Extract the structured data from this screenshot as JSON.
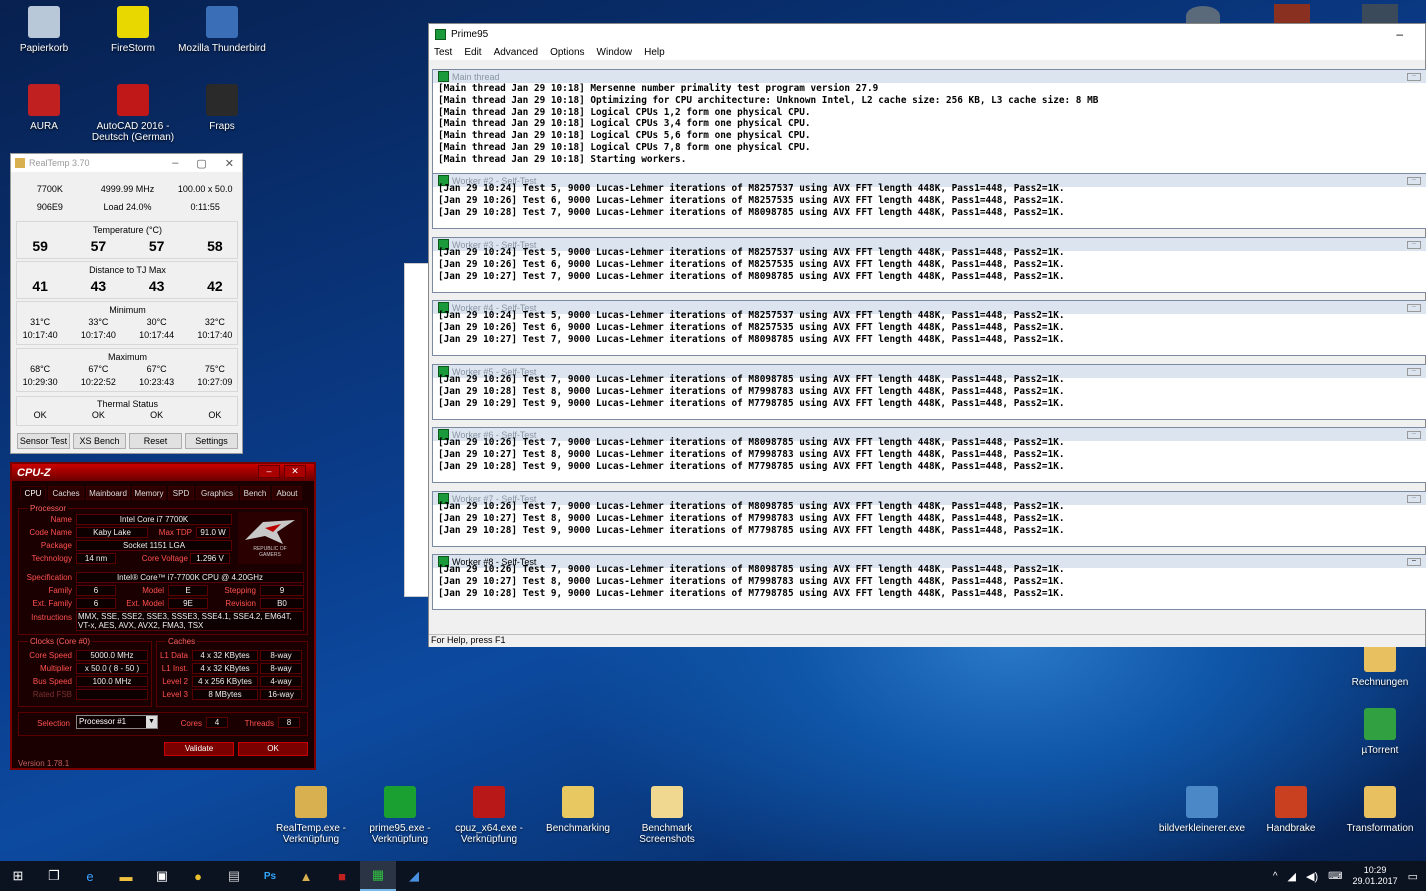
{
  "desktop_icons_left": [
    {
      "label": "Papierkorb",
      "icon": "recycle-bin-icon",
      "color": "#b8c8d8"
    },
    {
      "label": "FireStorm",
      "icon": "firestorm-icon",
      "color": "#e8d800"
    },
    {
      "label": "Mozilla Thunderbird",
      "icon": "thunderbird-icon",
      "color": "#3a6fb8"
    },
    {
      "label": "AURA",
      "icon": "aura-icon",
      "color": "#c02020"
    },
    {
      "label": "AutoCAD 2016 - Deutsch (German)",
      "icon": "autocad-icon",
      "color": "#c01818"
    },
    {
      "label": "Fraps",
      "icon": "fraps-icon",
      "color": "#2a2a2a"
    }
  ],
  "desktop_icons_bottom": [
    {
      "label": "RealTemp.exe - Verknüpfung",
      "icon": "realtemp-icon",
      "color": "#d8b050"
    },
    {
      "label": "prime95.exe - Verknüpfung",
      "icon": "prime95-icon",
      "color": "#1aa030"
    },
    {
      "label": "cpuz_x64.exe - Verknüpfung",
      "icon": "cpuz-icon",
      "color": "#b81818"
    },
    {
      "label": "Benchmarking",
      "icon": "folder-icon",
      "color": "#e8c860"
    },
    {
      "label": "Benchmark Screenshots",
      "icon": "folder-icon",
      "color": "#f0d890"
    }
  ],
  "desktop_icons_right": [
    {
      "label": "bildverkleinerer.exe",
      "icon": "image-resizer-icon",
      "color": "#4a88c8"
    },
    {
      "label": "Handbrake",
      "icon": "handbrake-icon",
      "color": "#c84020"
    },
    {
      "label": "Transformation",
      "icon": "folder-icon",
      "color": "#e8c060"
    },
    {
      "label": "Rechnungen",
      "icon": "folder-icon",
      "color": "#e8c060"
    },
    {
      "label": "µTorrent",
      "icon": "utorrent-icon",
      "color": "#30a040"
    }
  ],
  "realtemp": {
    "title": "RealTemp 3.70",
    "cpu": "7700K",
    "mhz": "4999.99 MHz",
    "mult": "100.00 x 50.0",
    "cpuid": "906E9",
    "load": "Load  24.0%",
    "time": "0:11:55",
    "temp_title": "Temperature (°C)",
    "temps": [
      "59",
      "57",
      "57",
      "58"
    ],
    "dist_title": "Distance to TJ Max",
    "dists": [
      "41",
      "43",
      "43",
      "42"
    ],
    "min_title": "Minimum",
    "min_vals": [
      "31°C",
      "33°C",
      "30°C",
      "32°C"
    ],
    "min_times": [
      "10:17:40",
      "10:17:40",
      "10:17:44",
      "10:17:40"
    ],
    "max_title": "Maximum",
    "max_vals": [
      "68°C",
      "67°C",
      "67°C",
      "75°C"
    ],
    "max_times": [
      "10:29:30",
      "10:22:52",
      "10:23:43",
      "10:27:09"
    ],
    "thermal_title": "Thermal Status",
    "thermal": [
      "OK",
      "OK",
      "OK",
      "OK"
    ],
    "buttons": [
      "Sensor Test",
      "XS Bench",
      "Reset",
      "Settings"
    ]
  },
  "cpuz": {
    "title": "CPU-Z",
    "tabs": [
      "CPU",
      "Caches",
      "Mainboard",
      "Memory",
      "SPD",
      "Graphics",
      "Bench",
      "About"
    ],
    "processor_group": "Processor",
    "name_label": "Name",
    "name": "Intel Core i7 7700K",
    "codename_label": "Code Name",
    "codename": "Kaby Lake",
    "maxtdp_label": "Max TDP",
    "maxtdp": "91.0 W",
    "package_label": "Package",
    "package": "Socket 1151 LGA",
    "tech_label": "Technology",
    "tech": "14 nm",
    "corevolt_label": "Core Voltage",
    "corevolt": "1.296 V",
    "spec_label": "Specification",
    "spec": "Intel® Core™ i7-7700K CPU @ 4.20GHz",
    "family_label": "Family",
    "family": "6",
    "model_label": "Model",
    "model": "E",
    "stepping_label": "Stepping",
    "stepping": "9",
    "extfamily_label": "Ext. Family",
    "extfamily": "6",
    "extmodel_label": "Ext. Model",
    "extmodel": "9E",
    "revision_label": "Revision",
    "revision": "B0",
    "instr_label": "Instructions",
    "instr": "MMX, SSE, SSE2, SSE3, SSSE3, SSE4.1, SSE4.2, EM64T, VT-x, AES, AVX, AVX2, FMA3, TSX",
    "clocks_group": "Clocks (Core #0)",
    "corespeed_label": "Core Speed",
    "corespeed": "5000.0 MHz",
    "multiplier_label": "Multiplier",
    "multiplier": "x 50.0 ( 8 - 50 )",
    "busspeed_label": "Bus Speed",
    "busspeed": "100.0 MHz",
    "ratedfsb_label": "Rated FSB",
    "ratedfsb": "",
    "caches_group": "Caches",
    "l1d_label": "L1 Data",
    "l1d": "4 x 32 KBytes",
    "l1d_way": "8-way",
    "l1i_label": "L1 Inst.",
    "l1i": "4 x 32 KBytes",
    "l1i_way": "8-way",
    "l2_label": "Level 2",
    "l2": "4 x 256 KBytes",
    "l2_way": "4-way",
    "l3_label": "Level 3",
    "l3": "8 MBytes",
    "l3_way": "16-way",
    "selection_label": "Selection",
    "selection": "Processor #1",
    "cores_label": "Cores",
    "cores": "4",
    "threads_label": "Threads",
    "threads": "8",
    "validate": "Validate",
    "ok": "OK",
    "version": "Version 1.78.1",
    "logo_text": "REPUBLIC OF GAMERS"
  },
  "prime95": {
    "title": "Prime95",
    "menu": [
      "Test",
      "Edit",
      "Advanced",
      "Options",
      "Window",
      "Help"
    ],
    "status": "For Help, press F1",
    "windows": [
      {
        "title": "Main thread",
        "lines": [
          "[Main thread Jan 29 10:18] Mersenne number primality test program version 27.9",
          "[Main thread Jan 29 10:18] Optimizing for CPU architecture: Unknown Intel, L2 cache size: 256 KB, L3 cache size: 8 MB",
          "[Main thread Jan 29 10:18] Logical CPUs 1,2 form one physical CPU.",
          "[Main thread Jan 29 10:18] Logical CPUs 3,4 form one physical CPU.",
          "[Main thread Jan 29 10:18] Logical CPUs 5,6 form one physical CPU.",
          "[Main thread Jan 29 10:18] Logical CPUs 7,8 form one physical CPU.",
          "[Main thread Jan 29 10:18] Starting workers."
        ]
      },
      {
        "title": "Worker #2 - Self-Test",
        "lines": [
          "[Jan 29 10:24] Test 5, 9000 Lucas-Lehmer iterations of M8257537 using AVX FFT length 448K, Pass1=448, Pass2=1K.",
          "[Jan 29 10:26] Test 6, 9000 Lucas-Lehmer iterations of M8257535 using AVX FFT length 448K, Pass1=448, Pass2=1K.",
          "[Jan 29 10:28] Test 7, 9000 Lucas-Lehmer iterations of M8098785 using AVX FFT length 448K, Pass1=448, Pass2=1K."
        ]
      },
      {
        "title": "Worker #3 - Self-Test",
        "lines": [
          "[Jan 29 10:24] Test 5, 9000 Lucas-Lehmer iterations of M8257537 using AVX FFT length 448K, Pass1=448, Pass2=1K.",
          "[Jan 29 10:26] Test 6, 9000 Lucas-Lehmer iterations of M8257535 using AVX FFT length 448K, Pass1=448, Pass2=1K.",
          "[Jan 29 10:27] Test 7, 9000 Lucas-Lehmer iterations of M8098785 using AVX FFT length 448K, Pass1=448, Pass2=1K."
        ]
      },
      {
        "title": "Worker #4 - Self-Test",
        "lines": [
          "[Jan 29 10:24] Test 5, 9000 Lucas-Lehmer iterations of M8257537 using AVX FFT length 448K, Pass1=448, Pass2=1K.",
          "[Jan 29 10:26] Test 6, 9000 Lucas-Lehmer iterations of M8257535 using AVX FFT length 448K, Pass1=448, Pass2=1K.",
          "[Jan 29 10:27] Test 7, 9000 Lucas-Lehmer iterations of M8098785 using AVX FFT length 448K, Pass1=448, Pass2=1K."
        ]
      },
      {
        "title": "Worker #5 - Self-Test",
        "lines": [
          "[Jan 29 10:26] Test 7, 9000 Lucas-Lehmer iterations of M8098785 using AVX FFT length 448K, Pass1=448, Pass2=1K.",
          "[Jan 29 10:28] Test 8, 9000 Lucas-Lehmer iterations of M7998783 using AVX FFT length 448K, Pass1=448, Pass2=1K.",
          "[Jan 29 10:29] Test 9, 9000 Lucas-Lehmer iterations of M7798785 using AVX FFT length 448K, Pass1=448, Pass2=1K."
        ]
      },
      {
        "title": "Worker #6 - Self-Test",
        "lines": [
          "[Jan 29 10:26] Test 7, 9000 Lucas-Lehmer iterations of M8098785 using AVX FFT length 448K, Pass1=448, Pass2=1K.",
          "[Jan 29 10:27] Test 8, 9000 Lucas-Lehmer iterations of M7998783 using AVX FFT length 448K, Pass1=448, Pass2=1K.",
          "[Jan 29 10:28] Test 9, 9000 Lucas-Lehmer iterations of M7798785 using AVX FFT length 448K, Pass1=448, Pass2=1K."
        ]
      },
      {
        "title": "Worker #7 - Self-Test",
        "lines": [
          "[Jan 29 10:26] Test 7, 9000 Lucas-Lehmer iterations of M8098785 using AVX FFT length 448K, Pass1=448, Pass2=1K.",
          "[Jan 29 10:27] Test 8, 9000 Lucas-Lehmer iterations of M7998783 using AVX FFT length 448K, Pass1=448, Pass2=1K.",
          "[Jan 29 10:28] Test 9, 9000 Lucas-Lehmer iterations of M7798785 using AVX FFT length 448K, Pass1=448, Pass2=1K."
        ]
      },
      {
        "title": "Worker #8 - Self-Test",
        "lines": [
          "[Jan 29 10:26] Test 7, 9000 Lucas-Lehmer iterations of M8098785 using AVX FFT length 448K, Pass1=448, Pass2=1K.",
          "[Jan 29 10:27] Test 8, 9000 Lucas-Lehmer iterations of M7998783 using AVX FFT length 448K, Pass1=448, Pass2=1K.",
          "[Jan 29 10:28] Test 9, 9000 Lucas-Lehmer iterations of M7798785 using AVX FFT length 448K, Pass1=448, Pass2=1K."
        ]
      }
    ]
  },
  "taskbar": {
    "time": "10:29",
    "date": "29.01.2017",
    "items": [
      {
        "icon": "start-icon",
        "glyph": "⊞",
        "color": "#ffffff"
      },
      {
        "icon": "task-view-icon",
        "glyph": "❐",
        "color": "#ffffff"
      },
      {
        "icon": "edge-icon",
        "glyph": "e",
        "color": "#3aa0ff"
      },
      {
        "icon": "file-explorer-icon",
        "glyph": "▬",
        "color": "#f0c040"
      },
      {
        "icon": "store-icon",
        "glyph": "▣",
        "color": "#ffffff"
      },
      {
        "icon": "chrome-icon",
        "glyph": "●",
        "color": "#e8c030"
      },
      {
        "icon": "monitor-app-icon",
        "glyph": "▤",
        "color": "#cccccc"
      },
      {
        "icon": "photoshop-icon",
        "glyph": "Ps",
        "color": "#31a8ff"
      },
      {
        "icon": "realtemp-taskbar-icon",
        "glyph": "▲",
        "color": "#d8b050"
      },
      {
        "icon": "cpuz-taskbar-icon",
        "glyph": "■",
        "color": "#c02020"
      },
      {
        "icon": "prime95-taskbar-icon",
        "glyph": "▦",
        "color": "#30c040"
      },
      {
        "icon": "autocad-taskbar-icon",
        "glyph": "◢",
        "color": "#4a90e0"
      }
    ]
  }
}
